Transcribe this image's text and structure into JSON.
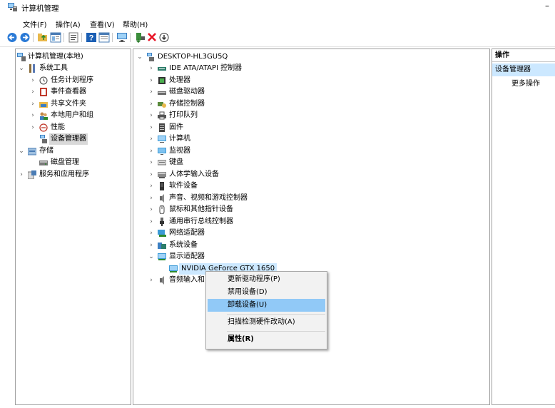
{
  "window": {
    "title": "计算机管理",
    "minimize": "–"
  },
  "menu": [
    "文件(F)",
    "操作(A)",
    "查看(V)",
    "帮助(H)"
  ],
  "toolbar_icons": [
    "back-arrow-icon",
    "forward-arrow-icon",
    "folder-up-icon",
    "show-hide-tree-icon",
    "properties-icon",
    "help-icon",
    "details-icon",
    "computer-icon",
    "update-driver-icon",
    "remove-icon",
    "install-icon"
  ],
  "left_tree": {
    "root": "计算机管理(本地)",
    "system_tools": "系统工具",
    "task_scheduler": "任务计划程序",
    "event_viewer": "事件查看器",
    "shared_folders": "共享文件夹",
    "local_users": "本地用户和组",
    "performance": "性能",
    "device_manager": "设备管理器",
    "storage": "存储",
    "disk_management": "磁盘管理",
    "services": "服务和应用程序"
  },
  "device_tree": {
    "computer_name": "DESKTOP-HL3GU5Q",
    "categories": [
      "IDE ATA/ATAPI 控制器",
      "处理器",
      "磁盘驱动器",
      "存储控制器",
      "打印队列",
      "固件",
      "计算机",
      "监视器",
      "键盘",
      "人体学输入设备",
      "软件设备",
      "声音、视频和游戏控制器",
      "鼠标和其他指针设备",
      "通用串行总线控制器",
      "网络适配器",
      "系统设备",
      "显示适配器"
    ],
    "gpu_device": "NVIDIA GeForce GTX 1650",
    "audio_io": "音频输入和"
  },
  "actions_pane": {
    "header": "操作",
    "selected": "设备管理器",
    "more": "更多操作"
  },
  "context_menu": {
    "update_driver": "更新驱动程序(P)",
    "disable_device": "禁用设备(D)",
    "uninstall_device": "卸载设备(U)",
    "scan_hardware": "扫描检测硬件改动(A)",
    "properties": "属性(R)"
  },
  "colors": {
    "selection_blue": "#cce8ff",
    "menu_highlight": "#91c9f7",
    "remove_red": "#e81123"
  }
}
